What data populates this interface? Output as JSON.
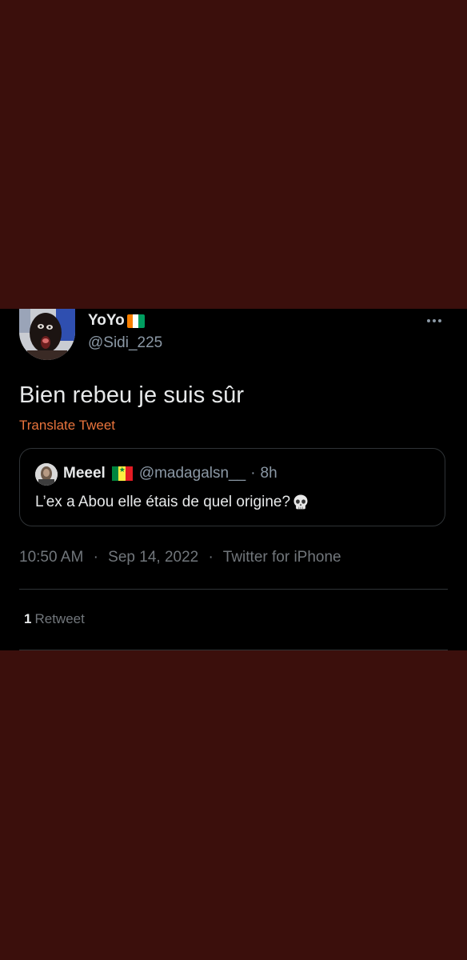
{
  "author": {
    "display_name": "YoYo",
    "handle": "@Sidi_225",
    "flag_icon": "cote-divoire-flag-icon"
  },
  "tweet": {
    "text": "Bien rebeu je suis sûr",
    "translate_label": "Translate Tweet"
  },
  "quote": {
    "name": "Meeel",
    "flag_icon": "senegal-flag-icon",
    "handle": "@madagalsn__",
    "separator": "·",
    "time": "8h",
    "text": "L’ex a Abou elle étais de quel origine?",
    "trailing_icon": "skull-emoji-icon"
  },
  "meta": {
    "time": "10:50 AM",
    "separator": "·",
    "date": "Sep 14, 2022",
    "source": "Twitter for iPhone"
  },
  "stats": {
    "retweet_count": "1",
    "retweet_label": "Retweet"
  },
  "colors": {
    "background": "#3b0f0c",
    "card_background": "#000000",
    "text_primary": "#e7e9ea",
    "text_secondary": "#71767b",
    "accent_link": "#e9743c",
    "border": "#2f3336"
  }
}
